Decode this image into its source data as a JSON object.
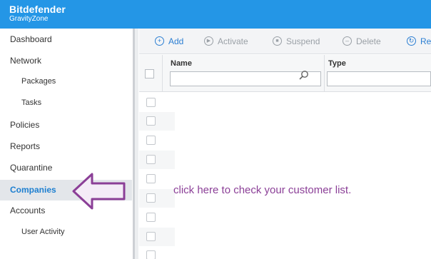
{
  "header": {
    "brand": "Bitdefender",
    "product": "GravityZone",
    "bg_color": "#2496e6"
  },
  "sidebar": {
    "items": [
      {
        "label": "Dashboard"
      },
      {
        "label": "Network"
      },
      {
        "label": "Packages"
      },
      {
        "label": "Tasks"
      },
      {
        "label": "Policies"
      },
      {
        "label": "Reports"
      },
      {
        "label": "Quarantine"
      },
      {
        "label": "Companies"
      },
      {
        "label": "Accounts"
      },
      {
        "label": "User Activity"
      }
    ],
    "active_item": "Companies",
    "active_color": "#1d7fd0"
  },
  "toolbar": {
    "add": {
      "label": "Add",
      "icon": "plus-circle-icon"
    },
    "activate": {
      "label": "Activate",
      "icon": "play-circle-icon"
    },
    "suspend": {
      "label": "Suspend",
      "icon": "stop-circle-icon"
    },
    "delete": {
      "label": "Delete",
      "icon": "minus-circle-icon"
    },
    "refresh": {
      "label": "Re",
      "icon": "refresh-icon"
    }
  },
  "table": {
    "columns": [
      {
        "header": "Name",
        "filter_placeholder": ""
      },
      {
        "header": "Type",
        "filter_placeholder": ""
      }
    ]
  },
  "annotation": {
    "text": "click here to check your customer list.",
    "color": "#8b3f97"
  }
}
